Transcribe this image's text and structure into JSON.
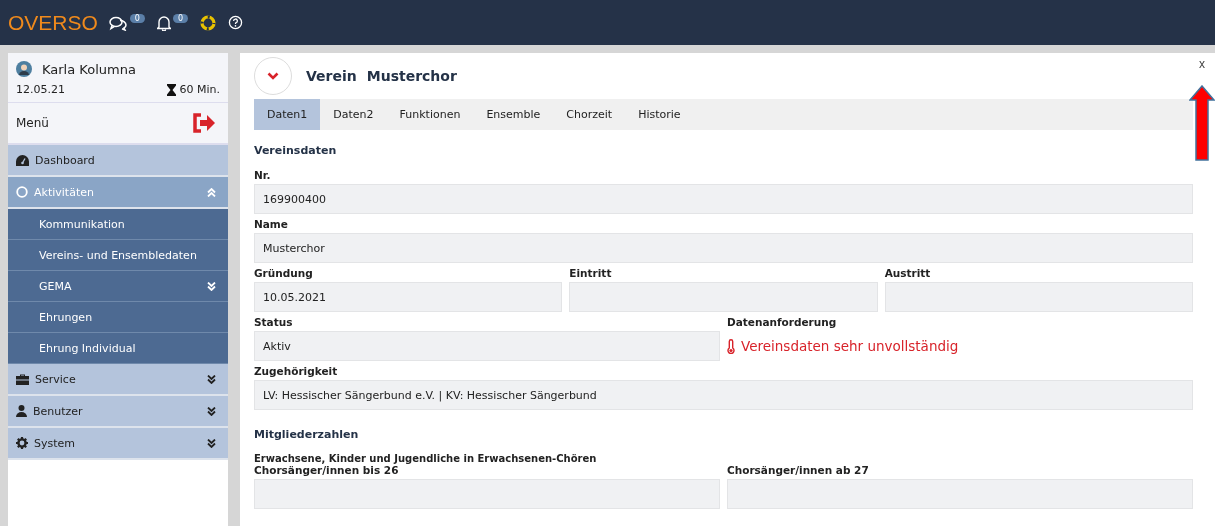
{
  "topbar": {
    "logo": "OVERSO",
    "messages_badge": "0",
    "notifications_badge": "0"
  },
  "user": {
    "name": "Karla Kolumna",
    "date": "12.05.21",
    "session": "60 Min."
  },
  "menu_label": "Menü",
  "menu": [
    {
      "label": "Dashboard",
      "kind": "link"
    },
    {
      "label": "Aktivitäten",
      "kind": "group",
      "expanded": true,
      "children": [
        {
          "label": "Kommunikation",
          "kind": "link"
        },
        {
          "label": "Vereins- und Ensembledaten",
          "kind": "link"
        },
        {
          "label": "GEMA",
          "kind": "group",
          "expanded": false
        },
        {
          "label": "Ehrungen",
          "kind": "link"
        },
        {
          "label": "Ehrung Individual",
          "kind": "link"
        }
      ]
    },
    {
      "label": "Service",
      "kind": "group",
      "expanded": false
    },
    {
      "label": "Benutzer",
      "kind": "group",
      "expanded": false
    },
    {
      "label": "System",
      "kind": "group",
      "expanded": false
    }
  ],
  "panel": {
    "type": "Verein",
    "name": "Musterchor",
    "close": "x"
  },
  "tabs": [
    {
      "label": "Daten1",
      "selected": true
    },
    {
      "label": "Daten2",
      "selected": false
    },
    {
      "label": "Funktionen",
      "selected": false
    },
    {
      "label": "Ensemble",
      "selected": false
    },
    {
      "label": "Chorzeit",
      "selected": false
    },
    {
      "label": "Historie",
      "selected": false
    }
  ],
  "form": [
    {
      "kind": "section",
      "text": "Vereinsdaten"
    },
    {
      "kind": "row",
      "fields": [
        {
          "kind": "input",
          "label": "Nr.",
          "value": "169900400"
        }
      ]
    },
    {
      "kind": "row",
      "fields": [
        {
          "kind": "input",
          "label": "Name",
          "value": "Musterchor"
        }
      ]
    },
    {
      "kind": "row",
      "fields": [
        {
          "kind": "input",
          "label": "Gründung",
          "value": "10.05.2021"
        },
        {
          "kind": "input",
          "label": "Eintritt"
        },
        {
          "kind": "input",
          "label": "Austritt"
        }
      ]
    },
    {
      "kind": "row",
      "fields": [
        {
          "kind": "input",
          "label": "Status",
          "value": "Aktiv"
        },
        {
          "kind": "alert",
          "label": "Datenanforderung",
          "value": "Vereinsdaten sehr unvollständig"
        }
      ]
    },
    {
      "kind": "row",
      "fields": [
        {
          "kind": "input",
          "label": "Zugehörigkeit",
          "value": "LV: Hessischer Sängerbund e.V. | KV: Hessischer Sängerbund"
        }
      ]
    },
    {
      "kind": "section",
      "text": "Mitgliederzahlen"
    },
    {
      "kind": "subsection",
      "text": "Erwachsene, Kinder und Jugendliche in Erwachsenen-Chören"
    },
    {
      "kind": "row",
      "fields": [
        {
          "kind": "input",
          "label": "Chorsänger/innen bis 26"
        },
        {
          "kind": "input",
          "label": "Chorsänger/innen ab 27"
        }
      ]
    }
  ]
}
